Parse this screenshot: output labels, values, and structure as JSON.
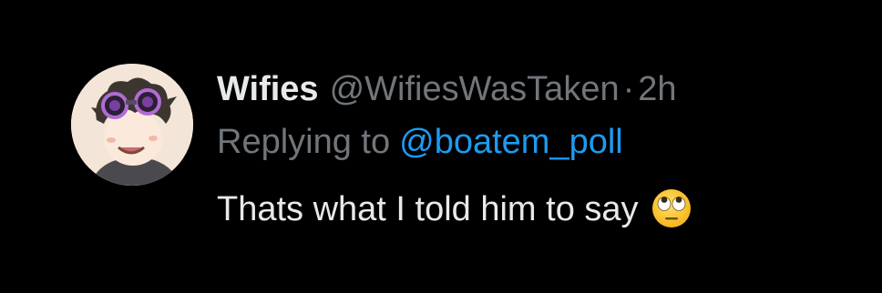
{
  "tweet": {
    "author": {
      "display_name": "Wifies",
      "handle": "@WifiesWasTaken",
      "avatar_icon": "cartoon-avatar-goggles"
    },
    "separator": "·",
    "time": "2h",
    "reply": {
      "prefix": "Replying to",
      "mention": "@boatem_poll"
    },
    "text": "Thats what I told him to say",
    "emoji_icon": "face-with-rolling-eyes-emoji"
  },
  "colors": {
    "background": "#000000",
    "primary_text": "#e7e9ea",
    "secondary_text": "#71767b",
    "link": "#1d9bf0"
  }
}
